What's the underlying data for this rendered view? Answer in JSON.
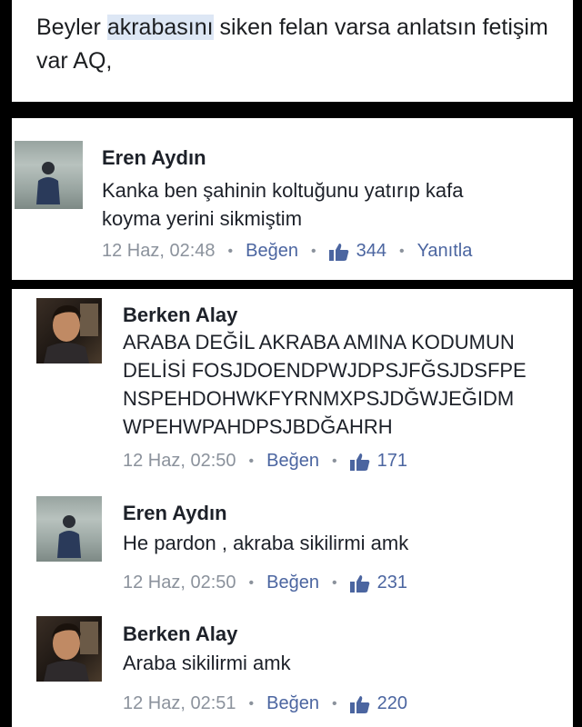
{
  "post": {
    "text_before": "Beyler ",
    "text_highlight": "akrabasını",
    "text_after": " siken felan varsa anlatsın fetişim var AQ,"
  },
  "comments": [
    {
      "author": "Eren Aydın",
      "lines": [
        "Kanka ben şahinin koltuğunu yatırıp kafa",
        "koyma yerini sikmiştim"
      ],
      "time": "12 Haz, 02:48",
      "like_label": "Beğen",
      "likes": "344",
      "reply_label": "Yanıtla",
      "avatar_icon": "user-avatar-icon"
    },
    {
      "author": "Berken Alay",
      "lines": [
        "ARABA DEĞİL AKRABA AMINA KODUMUN",
        "DELİSİ FOSJDOENDPWJDPSJFĞSJDSFPE",
        "NSPEHDOHWKFYRNMXPSJDĞWJEĞIDM",
        "WPEHWPAHDPSJBDĞAHRH"
      ],
      "time": "12 Haz, 02:50",
      "like_label": "Beğen",
      "likes": "171",
      "avatar_icon": "user-avatar-icon"
    },
    {
      "author": "Eren Aydın",
      "lines": [
        "He pardon , akraba sikilirmi amk"
      ],
      "time": "12 Haz, 02:50",
      "like_label": "Beğen",
      "likes": "231",
      "avatar_icon": "user-avatar-icon"
    },
    {
      "author": "Berken Alay",
      "lines": [
        "Araba sikilirmi amk"
      ],
      "time": "12 Haz, 02:51",
      "like_label": "Beğen",
      "likes": "220",
      "avatar_icon": "user-avatar-icon"
    }
  ],
  "colors": {
    "link": "#4b65a0",
    "meta": "#8b929c",
    "highlight": "#dde7f5"
  },
  "icons": {
    "separator": "•",
    "like": "thumbs-up-icon"
  }
}
